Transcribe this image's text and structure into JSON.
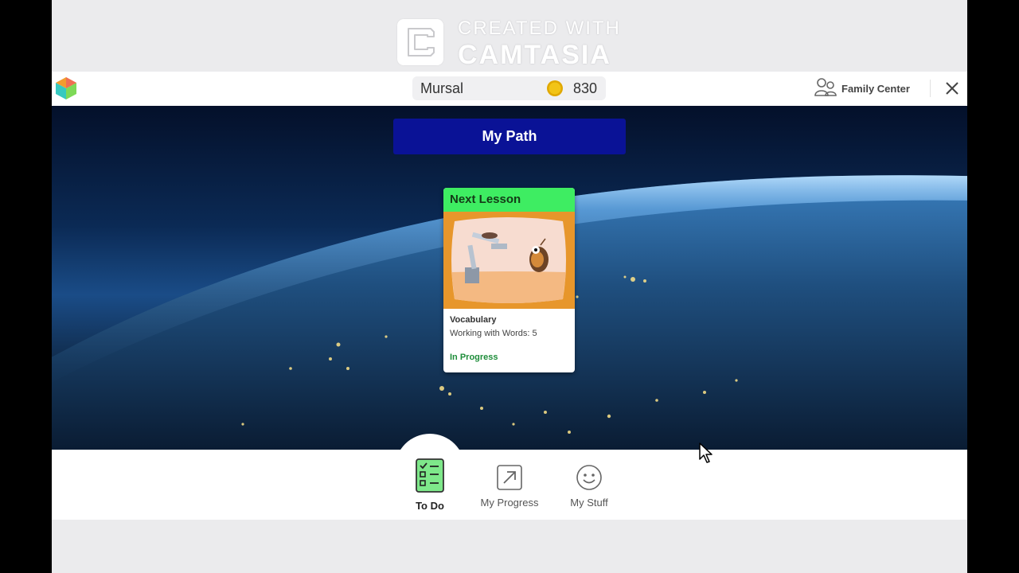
{
  "watermark": {
    "line1": "CREATED WITH",
    "line2": "CAMTASIA"
  },
  "topbar": {
    "username": "Mursal",
    "coins": "830",
    "family_center_label": "Family Center"
  },
  "main": {
    "path_button_label": "My Path",
    "lesson_card": {
      "header": "Next Lesson",
      "subject": "Vocabulary",
      "title": "Working with Words: 5",
      "status": "In Progress"
    }
  },
  "bottom_nav": {
    "items": [
      {
        "label": "To Do",
        "icon": "checklist-icon",
        "active": true
      },
      {
        "label": "My Progress",
        "icon": "arrow-up-right-box-icon",
        "active": false
      },
      {
        "label": "My Stuff",
        "icon": "smiley-face-icon",
        "active": false
      }
    ]
  },
  "colors": {
    "frame_background": "#ebebed",
    "path_button": "#0a1296",
    "card_header": "#3eed62",
    "card_image_bg": "#e7962b",
    "status_green": "#1e8d3a",
    "todo_icon_green": "#7ee88a",
    "coin": "#f2c417"
  }
}
